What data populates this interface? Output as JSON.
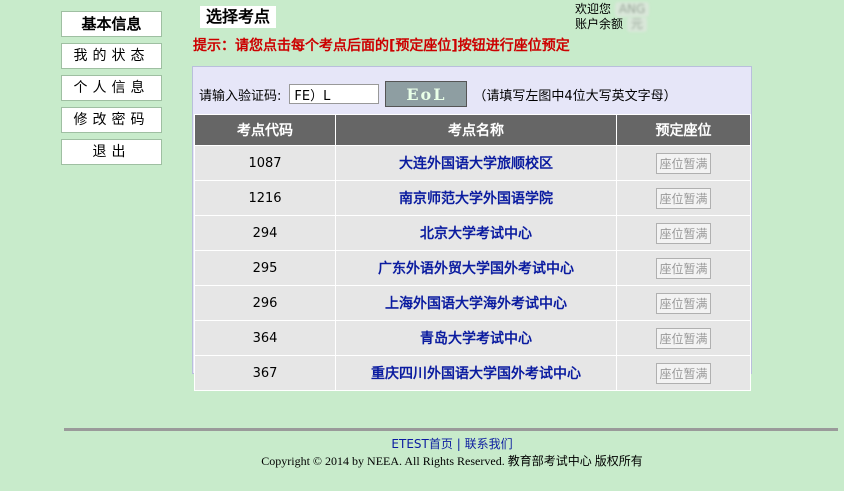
{
  "sidebar": {
    "header": "基本信息",
    "items": [
      "我的状态",
      "个人信息",
      "修改密码",
      "退出"
    ]
  },
  "page_title": "选择考点",
  "user_info": {
    "welcome": "欢迎您",
    "welcome_value": "ANG",
    "balance_label": "账户余额",
    "balance_value": "元"
  },
  "tip": "提示：请您点击每个考点后面的[预定座位]按钮进行座位预定",
  "captcha": {
    "label": "请输入验证码:",
    "value": "FE）L",
    "image_text": "EoL",
    "hint": "（请填写左图中4位大写英文字母）"
  },
  "table": {
    "headers": [
      "考点代码",
      "考点名称",
      "预定座位"
    ],
    "rows": [
      {
        "code": "1087",
        "name": "大连外国语大学旅顺校区",
        "action": "座位暂满"
      },
      {
        "code": "1216",
        "name": "南京师范大学外国语学院",
        "action": "座位暂满"
      },
      {
        "code": "294",
        "name": "北京大学考试中心",
        "action": "座位暂满"
      },
      {
        "code": "295",
        "name": "广东外语外贸大学国外考试中心",
        "action": "座位暂满"
      },
      {
        "code": "296",
        "name": "上海外国语大学海外考试中心",
        "action": "座位暂满"
      },
      {
        "code": "364",
        "name": "青岛大学考试中心",
        "action": "座位暂满"
      },
      {
        "code": "367",
        "name": "重庆四川外国语大学国外考试中心",
        "action": "座位暂满"
      }
    ]
  },
  "footer": {
    "link_home": "ETEST首页",
    "separator": "|",
    "link_contact": "联系我们",
    "copyright": "Copyright © 2014 by NEEA. All Rights Reserved. 教育部考试中心 版权所有"
  }
}
